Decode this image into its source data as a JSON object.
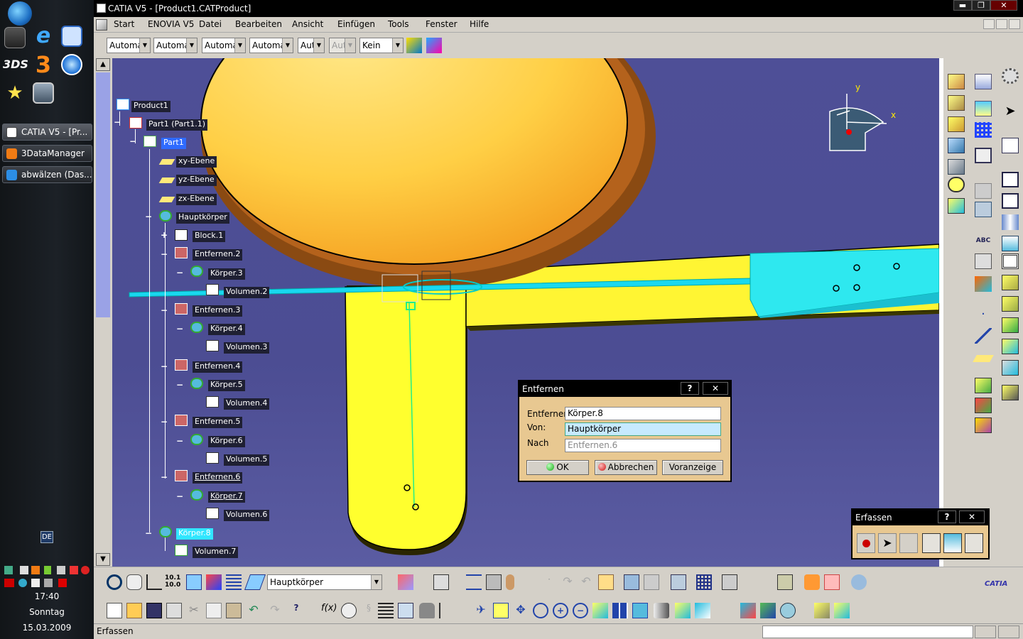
{
  "taskbar": {
    "tasks": [
      {
        "label": "CATIA V5 - [Pr..."
      },
      {
        "label": "3DataManager"
      },
      {
        "label": "abwälzen (Das..."
      }
    ],
    "language": "DE",
    "time": "17:40",
    "day": "Sonntag",
    "date": "15.03.2009"
  },
  "window": {
    "title": "CATIA V5 - [Product1.CATProduct]",
    "controls": {
      "minimize": "▬",
      "restore": "❐",
      "close": "✕"
    }
  },
  "menubar": {
    "items": [
      "Start",
      "ENOVIA V5",
      "Datei",
      "Bearbeiten",
      "Ansicht",
      "Einfügen",
      "Tools",
      "Fenster",
      "Hilfe"
    ]
  },
  "toolbar1": {
    "combos": [
      "Automa",
      "Automa",
      "Automa",
      "Automa",
      "Aut",
      "Aut",
      "Kein"
    ]
  },
  "tree": {
    "nodes": [
      {
        "label": "Product1"
      },
      {
        "label": "Part1 (Part1.1)"
      },
      {
        "label": "Part1"
      },
      {
        "label": "xy-Ebene"
      },
      {
        "label": "yz-Ebene"
      },
      {
        "label": "zx-Ebene"
      },
      {
        "label": "Hauptkörper"
      },
      {
        "label": "Block.1"
      },
      {
        "label": "Entfernen.2"
      },
      {
        "label": "Körper.3"
      },
      {
        "label": "Volumen.2"
      },
      {
        "label": "Entfernen.3"
      },
      {
        "label": "Körper.4"
      },
      {
        "label": "Volumen.3"
      },
      {
        "label": "Entfernen.4"
      },
      {
        "label": "Körper.5"
      },
      {
        "label": "Volumen.4"
      },
      {
        "label": "Entfernen.5"
      },
      {
        "label": "Körper.6"
      },
      {
        "label": "Volumen.5"
      },
      {
        "label": "Entfernen.6"
      },
      {
        "label": "Körper.7"
      },
      {
        "label": "Volumen.6"
      },
      {
        "label": "Körper.8"
      },
      {
        "label": "Volumen.7"
      }
    ]
  },
  "compass": {
    "x_label": "x",
    "y_label": "y"
  },
  "dialog_entfernen": {
    "title": "Entfernen",
    "help": "?",
    "close": "✕",
    "fields": [
      {
        "label": "Entfernen",
        "value": "Körper.8"
      },
      {
        "label": "Von:",
        "value": "Hauptkörper"
      },
      {
        "label": "Nach",
        "value": "Entfernen.6"
      }
    ],
    "buttons": {
      "ok": "OK",
      "cancel": "Abbrechen",
      "preview": "Voranzeige"
    }
  },
  "dialog_erfassen": {
    "title": "Erfassen",
    "help": "?",
    "close": "✕"
  },
  "bottom_toolbar": {
    "body_select": "Hauptkörper",
    "brand": "CATIA"
  },
  "status": {
    "text": "Erfassen"
  }
}
